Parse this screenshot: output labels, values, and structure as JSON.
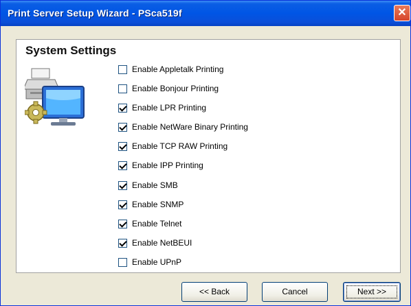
{
  "window": {
    "title": "Print Server Setup Wizard - PSca519f"
  },
  "page": {
    "heading": "System Settings"
  },
  "options": [
    {
      "label": "Enable Appletalk Printing",
      "checked": false
    },
    {
      "label": "Enable Bonjour Printing",
      "checked": false
    },
    {
      "label": "Enable LPR Printing",
      "checked": true
    },
    {
      "label": "Enable NetWare Binary Printing",
      "checked": true
    },
    {
      "label": "Enable TCP RAW Printing",
      "checked": true
    },
    {
      "label": "Enable IPP Printing",
      "checked": true
    },
    {
      "label": "Enable SMB",
      "checked": true
    },
    {
      "label": "Enable SNMP",
      "checked": true
    },
    {
      "label": "Enable Telnet",
      "checked": true
    },
    {
      "label": "Enable NetBEUI",
      "checked": true
    },
    {
      "label": "Enable UPnP",
      "checked": false
    }
  ],
  "buttons": {
    "back": "<< Back",
    "cancel": "Cancel",
    "next": "Next >>"
  },
  "icons": {
    "close": "close-icon",
    "settings": "printer-computer-gear-icon"
  }
}
